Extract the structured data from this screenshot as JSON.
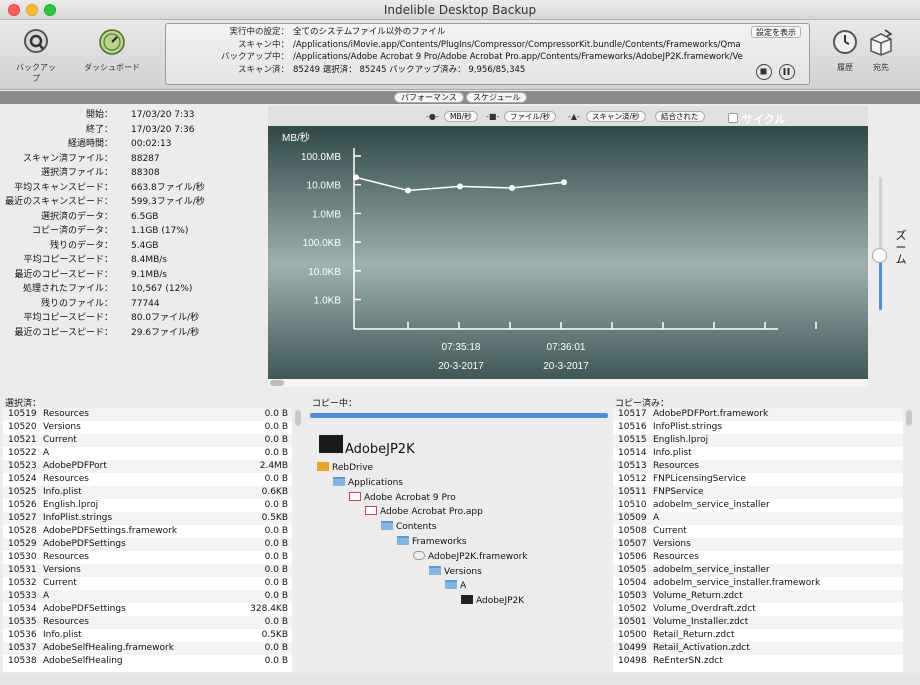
{
  "window": {
    "title": "Indelible Desktop Backup"
  },
  "toolbar": {
    "backup_label": "バックアップ",
    "dashboard_label": "ダッシュボード",
    "history_label": "履歴",
    "destination_label": "宛先"
  },
  "status": {
    "running_label": "実行中の設定：",
    "running_value": "全てのシステムファイル以外のファイル",
    "scanning_label": "スキャン中：",
    "scanning_value": "/Applications/iMovie.app/Contents/PlugIns/Compressor/CompressorKit.bundle/Contents/Frameworks/Qma",
    "backing_label": "バックアップ中：",
    "backing_value": "/Applications/Adobe Acrobat 9 Pro/Adobe Acrobat Pro.app/Contents/Frameworks/AdobeJP2K.framework/Ve",
    "scanned_label": "スキャン済：",
    "scanned_value": "85249    選択済： 85245 バックアップ済み： 9,956/85,345",
    "show_settings": "設定を表示"
  },
  "tabs": {
    "performance": "パフォーマンス",
    "schedule": "スケジュール"
  },
  "stats": [
    {
      "label": "開始：",
      "value": "17/03/20 7:33"
    },
    {
      "label": "終了：",
      "value": "17/03/20 7:36"
    },
    {
      "label": "経過時間：",
      "value": "00:02:13"
    },
    {
      "label": "スキャン済ファイル：",
      "value": "88287"
    },
    {
      "label": "選択済ファイル：",
      "value": "88308"
    },
    {
      "label": "平均スキャンスピード：",
      "value": "663.8ファイル/秒"
    },
    {
      "label": "最近のスキャンスピード：",
      "value": "599.3ファイル/秒"
    },
    {
      "label": "選択済のデータ：",
      "value": "6.5GB"
    },
    {
      "label": "コピー済のデータ：",
      "value": "1.1GB (17%)"
    },
    {
      "label": "残りのデータ：",
      "value": "5.4GB"
    },
    {
      "label": "平均コピースピード：",
      "value": "8.4MB/s"
    },
    {
      "label": "最近のコピースピード：",
      "value": "9.1MB/s"
    },
    {
      "label": "処理されたファイル：",
      "value": "10,567 (12%)"
    },
    {
      "label": "残りのファイル：",
      "value": "77744"
    },
    {
      "label": "平均コピースピード：",
      "value": "80.0ファイル/秒"
    },
    {
      "label": "最近のコピースピード：",
      "value": "29.6ファイル/秒"
    }
  ],
  "chart_legend": {
    "mbps": "MB/秒",
    "files": "ファイル/秒",
    "scanned": "スキャン済/秒",
    "combined": "結合された",
    "cycle": "サイクル"
  },
  "zoom_label": "ズーム",
  "chart_data": {
    "type": "line",
    "ylabel": "MB/秒",
    "yscale": "log",
    "yticks": [
      "100.0MB",
      "10.0MB",
      "1.0MB",
      "100.0KB",
      "10.0KB",
      "1.0KB"
    ],
    "ytick_values": [
      100,
      10,
      1,
      0.1,
      0.01,
      0.001
    ],
    "xticks": [
      {
        "time": "07:35:18",
        "date": "20-3-2017"
      },
      {
        "time": "07:36:01",
        "date": "20-3-2017"
      }
    ],
    "series": [
      {
        "name": "MB/秒",
        "values": [
          18,
          6.3,
          8.7,
          7.7,
          12.2
        ]
      }
    ]
  },
  "panes": {
    "selected_title": "選択済：",
    "copying_title": "コピー中：",
    "copied_title": "コピー済み："
  },
  "selected": [
    {
      "num": "10519",
      "name": "Resources",
      "size": "0.0 B"
    },
    {
      "num": "10520",
      "name": "Versions",
      "size": "0.0 B"
    },
    {
      "num": "10521",
      "name": "Current",
      "size": "0.0 B"
    },
    {
      "num": "10522",
      "name": "A",
      "size": "0.0 B"
    },
    {
      "num": "10523",
      "name": "AdobePDFPort",
      "size": "2.4MB"
    },
    {
      "num": "10524",
      "name": "Resources",
      "size": "0.0 B"
    },
    {
      "num": "10525",
      "name": "Info.plist",
      "size": "0.6KB"
    },
    {
      "num": "10526",
      "name": "English.lproj",
      "size": "0.0 B"
    },
    {
      "num": "10527",
      "name": "InfoPlist.strings",
      "size": "0.5KB"
    },
    {
      "num": "10528",
      "name": "AdobePDFSettings.framework",
      "size": "0.0 B"
    },
    {
      "num": "10529",
      "name": "AdobePDFSettings",
      "size": "0.0 B"
    },
    {
      "num": "10530",
      "name": "Resources",
      "size": "0.0 B"
    },
    {
      "num": "10531",
      "name": "Versions",
      "size": "0.0 B"
    },
    {
      "num": "10532",
      "name": "Current",
      "size": "0.0 B"
    },
    {
      "num": "10533",
      "name": "A",
      "size": "0.0 B"
    },
    {
      "num": "10534",
      "name": "AdobePDFSettings",
      "size": "328.4KB"
    },
    {
      "num": "10535",
      "name": "Resources",
      "size": "0.0 B"
    },
    {
      "num": "10536",
      "name": "Info.plist",
      "size": "0.5KB"
    },
    {
      "num": "10537",
      "name": "AdobeSelfHealing.framework",
      "size": "0.0 B"
    },
    {
      "num": "10538",
      "name": "AdobeSelfHealing",
      "size": "0.0 B"
    }
  ],
  "copying": {
    "header": "AdobeJP2K",
    "tree": [
      {
        "name": "RebDrive",
        "icon": "drive-icon"
      },
      {
        "name": "Applications",
        "icon": "folder-icon"
      },
      {
        "name": "Adobe Acrobat 9 Pro",
        "icon": "document-icon"
      },
      {
        "name": "Adobe Acrobat Pro.app",
        "icon": "acrobat-icon"
      },
      {
        "name": "Contents",
        "icon": "folder-icon"
      },
      {
        "name": "Frameworks",
        "icon": "folder-icon"
      },
      {
        "name": "AdobeJP2K.framework",
        "icon": "framework-icon"
      },
      {
        "name": "Versions",
        "icon": "folder-icon"
      },
      {
        "name": "A",
        "icon": "folder-icon"
      },
      {
        "name": "AdobeJP2K",
        "icon": "binary-icon"
      }
    ]
  },
  "copied": [
    {
      "num": "10517",
      "name": "AdobePDFPort.framework"
    },
    {
      "num": "10516",
      "name": "InfoPlist.strings"
    },
    {
      "num": "10515",
      "name": "English.lproj"
    },
    {
      "num": "10514",
      "name": "Info.plist"
    },
    {
      "num": "10513",
      "name": "Resources"
    },
    {
      "num": "10512",
      "name": "FNPLicensingService"
    },
    {
      "num": "10511",
      "name": "FNPService"
    },
    {
      "num": "10510",
      "name": "adobelm_service_installer"
    },
    {
      "num": "10509",
      "name": "A"
    },
    {
      "num": "10508",
      "name": "Current"
    },
    {
      "num": "10507",
      "name": "Versions"
    },
    {
      "num": "10506",
      "name": "Resources"
    },
    {
      "num": "10505",
      "name": "adobelm_service_installer"
    },
    {
      "num": "10504",
      "name": "adobelm_service_installer.framework"
    },
    {
      "num": "10503",
      "name": "Volume_Return.zdct"
    },
    {
      "num": "10502",
      "name": "Volume_Overdraft.zdct"
    },
    {
      "num": "10501",
      "name": "Volume_Installer.zdct"
    },
    {
      "num": "10500",
      "name": "Retail_Return.zdct"
    },
    {
      "num": "10499",
      "name": "Retail_Activation.zdct"
    },
    {
      "num": "10498",
      "name": "ReEnterSN.zdct"
    }
  ]
}
